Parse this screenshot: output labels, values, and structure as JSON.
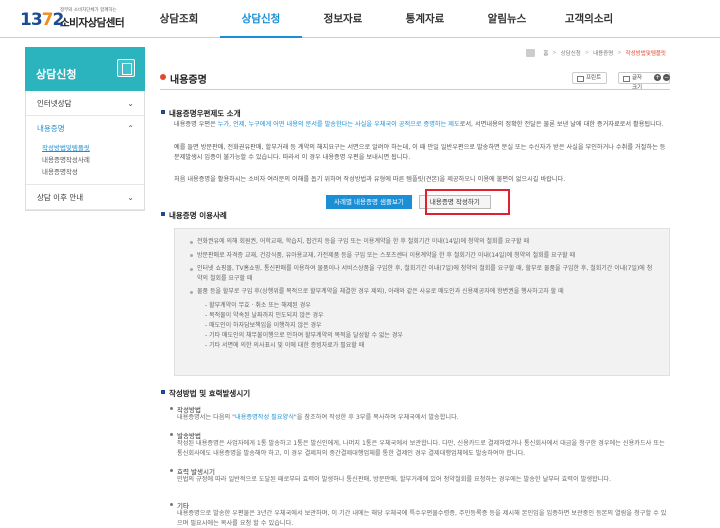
{
  "header": {
    "logo_num": "1372",
    "logo_sub": "정부와 소비자단체가 함께하는",
    "logo_name": "소비자상담센터",
    "nav": [
      "상담조회",
      "상담신청",
      "정보자료",
      "통계자료",
      "알림뉴스",
      "고객의소리"
    ]
  },
  "sidebar": {
    "title": "상담신청",
    "items": [
      {
        "label": "인터넷상담"
      },
      {
        "label": "내용증명"
      },
      {
        "label": "상담 이후 안내"
      }
    ],
    "sub_items": [
      "작성방법및템플릿",
      "내용증명작성사례",
      "내용증명작성"
    ]
  },
  "breadcrumb": [
    "홈",
    "상담신청",
    "내용증명",
    "작성방법및템플릿"
  ],
  "page": {
    "title": "내용증명",
    "print_label": "프린트",
    "font_label": "글자크기"
  },
  "intro": {
    "heading": "내용증명우편제도 소개",
    "p1_pre": "내용증명 우편은 ",
    "p1_hl": "누가, 언제, 누구에게 어떤 내용의 문서를 발송한다는 사실을 우체국이 공적으로 증명하는 제도",
    "p1_post": "로서, 서면내용의 정확한 전달은 물론 보낸 날에 대한 증거자료로서 활용됩니다.",
    "p2": "예를 들면 방문판매, 전화권유판매, 할부거래 등 계약의 해지요구는 서면으로 알려야 하는데, 이 때 만일 일반우편으로 발송하면 분실 또는 수신자가 받은 사실을 부인하거나 수취를 거절하는 등 문제발생시 입증이 불가능할 수 있습니다. 따라서 이 경우 내용증명 우편을 보내시면 됩니다.",
    "p3": "처음 내용증명을 활용하시는 소비자 여러분의 이해를 돕기 위하여 작성방법과 유형에 따른 템플릿(견본)을 제공하오니 이용에 불편이 없으시길 바랍니다.",
    "btn_samples": "사례별 내용증명 샘플보기",
    "btn_write": "내용증명 작성하기"
  },
  "usage": {
    "heading": "내용증명 이용사례",
    "items": [
      "전화권유에 의해 회원권, 어학교재, 학습지, 팝간지 등을 구입 또는 이용계약을 한 후 철회기간 이내(14일)에 청약의 철회를 요구할 때",
      "방문판매로 자격증 교재, 건강식품, 유아용교재, 가전제품 등을 구입 또는 스포츠센터 이용계약을 한 후 철회기간 이내(14일)에 청약의 철회를 요구할 때",
      "인터넷 쇼핑몰, TV홈쇼핑, 통신판매를 이용하여 물품이나 서비스상품을 구입한 후, 철회기간 이내(7일)에 청약의 철회를 요구할 때, 할부로 물품을 구입한 후, 철회기간 이내(7일)에 청약의 철회를 요구할 때",
      "물품 등을 할부로 구입 후(상행위를 목적으로 할부계약을 체결한 경우 제외), 아래와 같은 사유로 매도인과 신용제공자에 항변권을 행사하고자 할 때"
    ],
    "sub_items": [
      "- 할부계약이 무효 · 취소 또는 해제된 경우",
      "- 목적물이 약속된 날짜까지 인도되지 않은 경우",
      "- 매도인이 하자담보책임을 이행하지 않은 경우",
      "- 기타 매도인의 채무불이행으로 인하여 할부계약의 목적을 달성할 수 없는 경우",
      "- 기타 서면에 의한 의사표시 및 이에 대한 증빙자료가 필요할 때"
    ]
  },
  "method": {
    "heading": "작성방법 및 효력발생시기",
    "b1_title": "작성방법",
    "b1_pre": "내용증명서는 다음의 \"",
    "b1_hl": "내용증명작성 필요양식",
    "b1_post": "\"을 참조하여 작성한 후 3부를 복사하여 우체국에서 발송합니다.",
    "b2_title": "발송방법",
    "b2_text": "작성된 내용증명은 사업자에게 1통 발송하고 1통은 발신인에게, 나머지 1통은 우체국에서 보관합니다. 다만, 신용카드로 결제하였거나 통신회사에서 대금을 청구한 경우에는 신용카드사 또는 통신회사에도 내용증명을 발송해야 하고, 이 경우 결제처의 중간결제대행업체를 통한 결제인 경우 결제대행업체에도 발송하여야 합니다.",
    "b3_title": "효력 발생시기",
    "b3_text": "민법의 규정에 따라 일반적으로 도달된 때로부터 효력이 발생하나 통신판매, 방문판매, 할부거래에 있어 청약철회를 요청하는 경우에는 발송한 날부터 효력이 발생합니다.",
    "b4_title": "기타",
    "b4_text": "내용증명으로 발송한 우편물은 3년간 우체국에서 보관하며, 이 기간 내에는 해당 우체국에 특수우편물수령증, 주민등록증 등을 제시해 본인임을 입증하면 보관중인 등본의 열람을 청구할 수 있으며 필요시에는 복사를 요청 할 수 있습니다."
  }
}
